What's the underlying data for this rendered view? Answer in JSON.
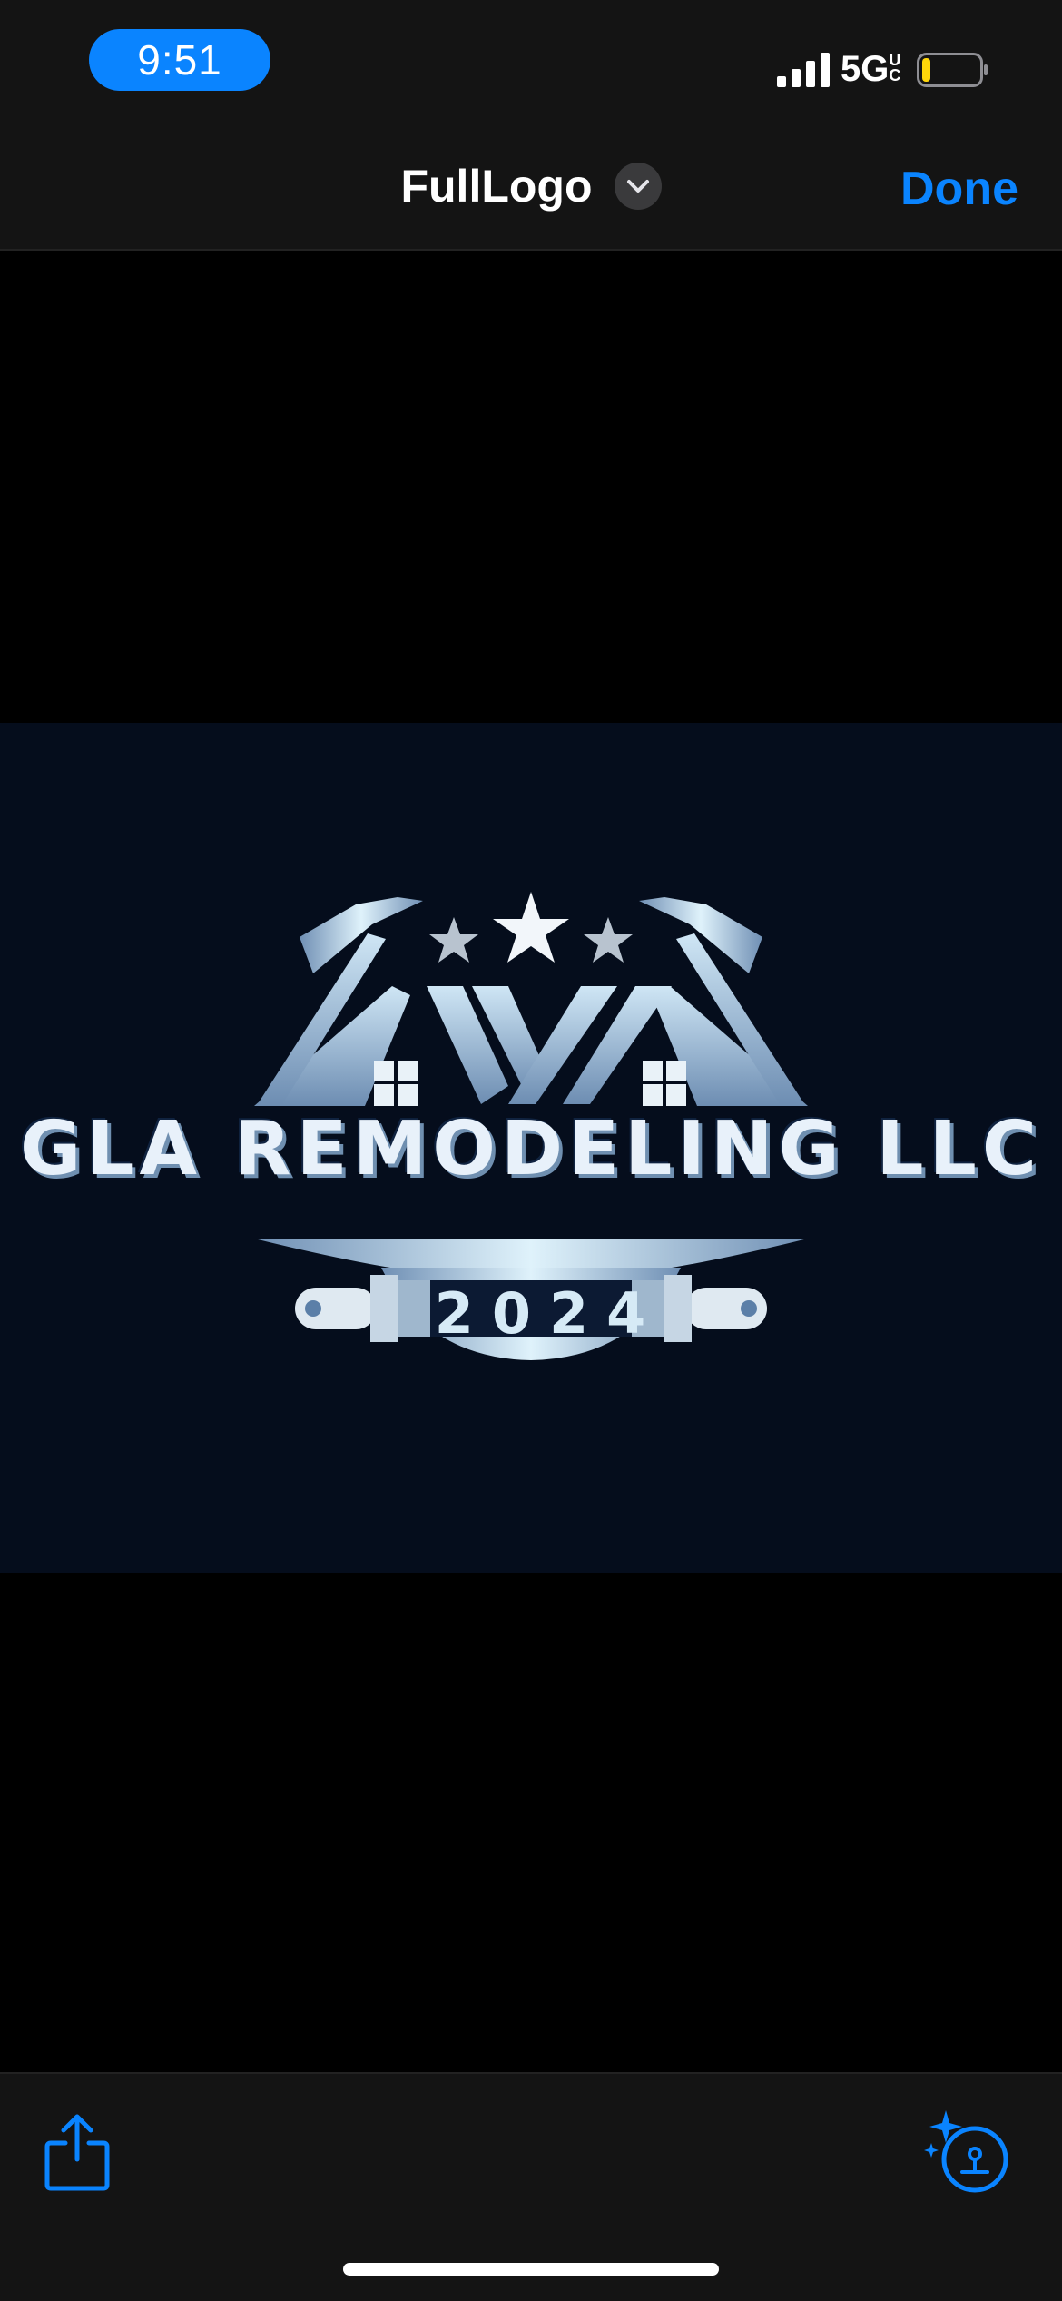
{
  "status_bar": {
    "time": "9:51",
    "network": "5G",
    "network_suffix": "UC",
    "battery_level": 0.15,
    "signal_bars": 4
  },
  "nav": {
    "title": "FullLogo",
    "done_label": "Done",
    "title_chevron_icon": "chevron-down-icon"
  },
  "image": {
    "logo_text": "GLA REMODELING LLC",
    "logo_year": "2024"
  },
  "toolbar": {
    "share_icon": "share-icon",
    "visual_lookup_icon": "visual-lookup-icon"
  },
  "colors": {
    "accent": "#0a84ff",
    "bar_bg": "#141414",
    "logo_bg": "#050d1c",
    "battery_fill": "#ffd60a"
  }
}
